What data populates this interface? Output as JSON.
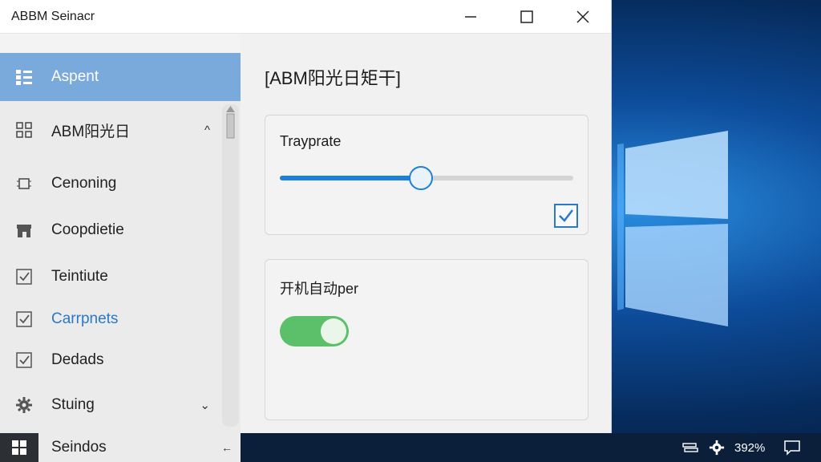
{
  "window": {
    "title": "ABBM Seinacr"
  },
  "sidebar": {
    "items": [
      {
        "label": "Aspent",
        "icon": "list-icon"
      },
      {
        "label": "ABM阳光日",
        "icon": "grid-icon"
      },
      {
        "label": "Cenoning",
        "icon": "chip-icon"
      },
      {
        "label": "Coopdietie",
        "icon": "store-icon"
      },
      {
        "label": "Teintiute",
        "icon": "checkbox-icon"
      },
      {
        "label": "Carrpnets",
        "icon": "checkbox-icon"
      },
      {
        "label": "Dedads",
        "icon": "checkbox-icon"
      },
      {
        "label": "Stuing",
        "icon": "gear-icon"
      },
      {
        "label": "Seindos",
        "icon": "windows-icon"
      }
    ],
    "chevron_up": "^",
    "chevron_down": "⌄",
    "chevron_left": "←"
  },
  "main": {
    "title": "[ABM阳光日矩干]",
    "card1": {
      "title": "Trayprate",
      "slider_value": 0.48,
      "checked": true
    },
    "card2": {
      "title": "开机自动per",
      "toggle_on": true
    }
  },
  "taskbar": {
    "battery": "392%"
  },
  "colors": {
    "accent": "#1e7fd8",
    "selected": "#7aa9dc",
    "toggle": "#5cbf6a"
  }
}
